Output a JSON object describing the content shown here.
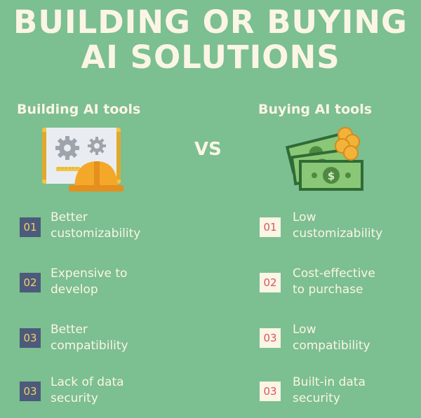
{
  "title": {
    "line1": "BUILDING OR BUYING",
    "line2": "AI SOLUTIONS"
  },
  "vs": "VS",
  "left": {
    "heading": "Building AI tools",
    "illustration": "blueprint-gears-hardhat-icon",
    "items": [
      {
        "num": "01",
        "line1": "Better",
        "line2": "customizability"
      },
      {
        "num": "02",
        "line1": "Expensive to",
        "line2": "develop"
      },
      {
        "num": "03",
        "line1": "Better",
        "line2": "compatibility"
      },
      {
        "num": "03",
        "line1": "Lack of data",
        "line2": "security"
      }
    ]
  },
  "right": {
    "heading": "Buying AI tools",
    "illustration": "money-coins-icon",
    "items": [
      {
        "num": "01",
        "line1": "Low",
        "line2": "customizability"
      },
      {
        "num": "02",
        "line1": "Cost-effective",
        "line2": "to purchase"
      },
      {
        "num": "03",
        "line1": "Low",
        "line2": "compatibility"
      },
      {
        "num": "03",
        "line1": "Built-in data",
        "line2": "security"
      }
    ]
  },
  "colors": {
    "background": "#7cbf90",
    "cream": "#fbf5e6",
    "badge_dark": "#4c5a7b",
    "badge_dark_text": "#f4d06b",
    "badge_light_text": "#d45a5a"
  }
}
